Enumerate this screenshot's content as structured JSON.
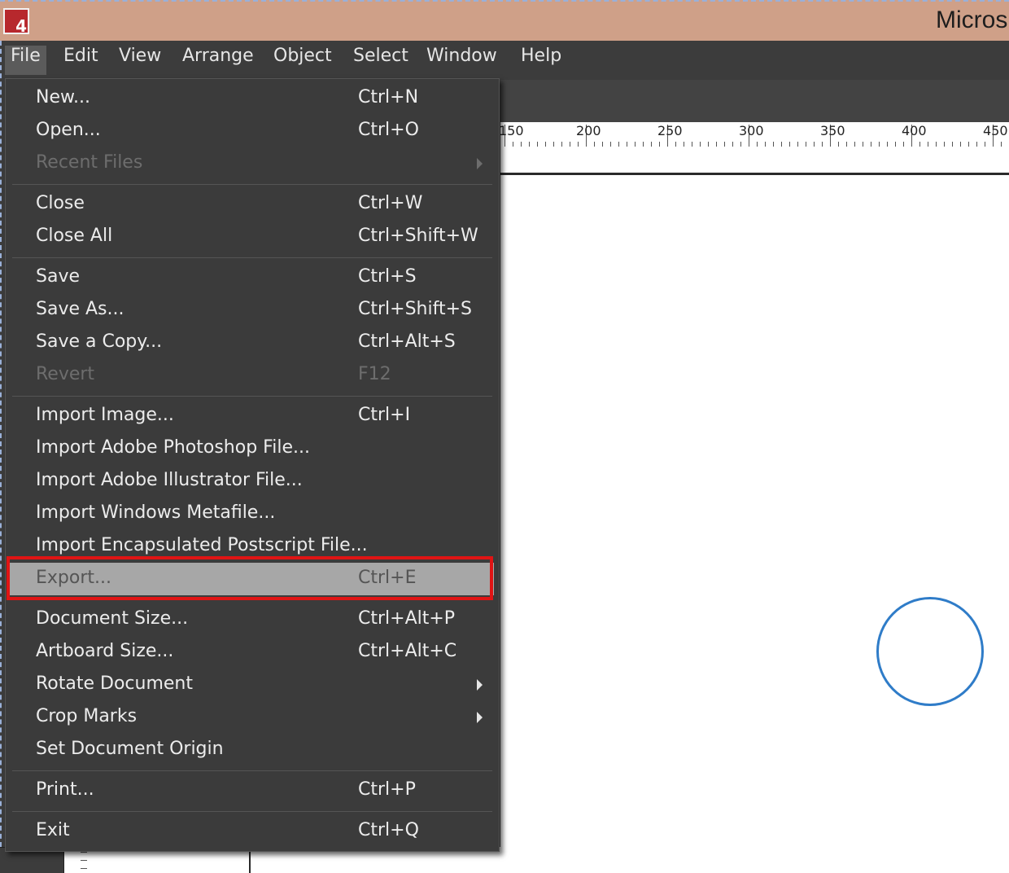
{
  "window": {
    "title": "Micros",
    "icon_glyph": "4"
  },
  "menubar": {
    "items": [
      {
        "label": "File",
        "active": true
      },
      {
        "label": "Edit"
      },
      {
        "label": "View"
      },
      {
        "label": "Arrange"
      },
      {
        "label": "Object"
      },
      {
        "label": "Select"
      },
      {
        "label": "Window"
      },
      {
        "label": "Help"
      }
    ]
  },
  "ruler": {
    "labels": [
      "150",
      "200",
      "250",
      "300",
      "350",
      "400",
      "450"
    ]
  },
  "file_menu": {
    "items": [
      {
        "label": "New...",
        "shortcut": "Ctrl+N"
      },
      {
        "label": "Open...",
        "shortcut": "Ctrl+O"
      },
      {
        "label": "Recent Files",
        "shortcut": "",
        "disabled": true,
        "submenu": true
      },
      {
        "label": "Close",
        "shortcut": "Ctrl+W"
      },
      {
        "label": "Close All",
        "shortcut": "Ctrl+Shift+W"
      },
      {
        "label": "Save",
        "shortcut": "Ctrl+S"
      },
      {
        "label": "Save As...",
        "shortcut": "Ctrl+Shift+S"
      },
      {
        "label": "Save a Copy...",
        "shortcut": "Ctrl+Alt+S"
      },
      {
        "label": "Revert",
        "shortcut": "F12",
        "disabled": true
      },
      {
        "label": "Import Image...",
        "shortcut": "Ctrl+I"
      },
      {
        "label": "Import Adobe Photoshop File...",
        "shortcut": ""
      },
      {
        "label": "Import Adobe Illustrator File...",
        "shortcut": ""
      },
      {
        "label": "Import Windows Metafile...",
        "shortcut": ""
      },
      {
        "label": "Import Encapsulated Postscript File...",
        "shortcut": ""
      },
      {
        "label": "Export...",
        "shortcut": "Ctrl+E",
        "highlighted": true
      },
      {
        "label": "Document Size...",
        "shortcut": "Ctrl+Alt+P"
      },
      {
        "label": "Artboard Size...",
        "shortcut": "Ctrl+Alt+C"
      },
      {
        "label": "Rotate Document",
        "shortcut": "",
        "submenu": true
      },
      {
        "label": "Crop Marks",
        "shortcut": "",
        "submenu": true
      },
      {
        "label": "Set Document Origin",
        "shortcut": ""
      },
      {
        "label": "Print...",
        "shortcut": "Ctrl+P"
      },
      {
        "label": "Exit",
        "shortcut": "Ctrl+Q"
      }
    ]
  },
  "colors": {
    "titlebar": "#cfa088",
    "menu_bg": "#3b3b3b",
    "highlight": "#a7a7a7",
    "annotation_outline": "#e01414",
    "shape_stroke": "#2f7cc8"
  }
}
